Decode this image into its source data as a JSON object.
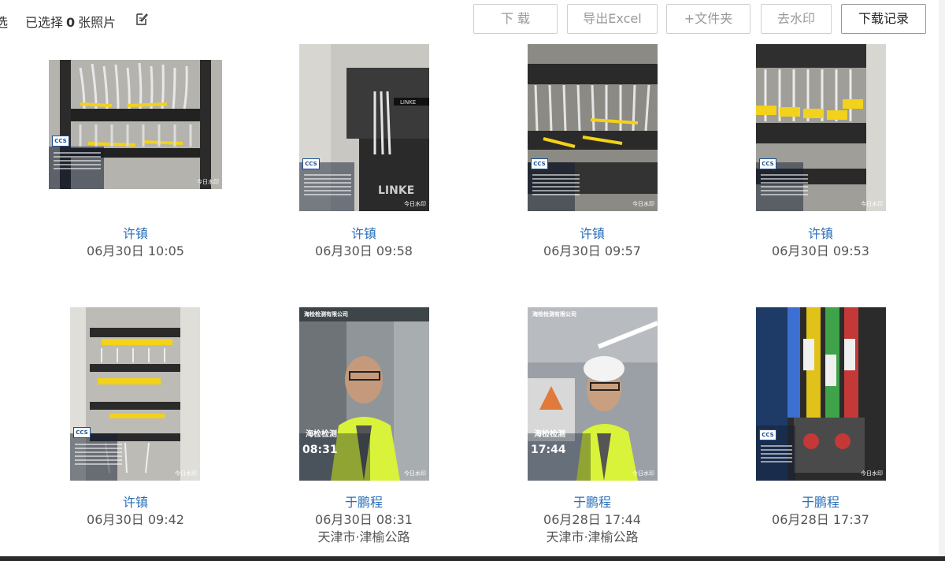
{
  "toolbar": {
    "select_all_fragment": "选",
    "selected_prefix": "已选择",
    "selected_count": "0",
    "selected_suffix": "张照片",
    "buttons": {
      "download": "下 载",
      "export_excel": "导出Excel",
      "add_folder": "+文件夹",
      "remove_watermark": "去水印",
      "download_history": "下载记录"
    }
  },
  "photos": [
    {
      "name": "许镇",
      "time": "06月30日 10:05",
      "location": ""
    },
    {
      "name": "许镇",
      "time": "06月30日 09:58",
      "location": ""
    },
    {
      "name": "许镇",
      "time": "06月30日 09:57",
      "location": ""
    },
    {
      "name": "许镇",
      "time": "06月30日 09:53",
      "location": ""
    },
    {
      "name": "许镇",
      "time": "06月30日 09:42",
      "location": ""
    },
    {
      "name": "于鹏程",
      "time": "06月30日 08:31",
      "location": "天津市·津榆公路"
    },
    {
      "name": "于鹏程",
      "time": "06月28日 17:44",
      "location": "天津市·津榆公路"
    },
    {
      "name": "于鹏程",
      "time": "06月28日 17:37",
      "location": ""
    }
  ],
  "photo_overlays": {
    "ccs_logo": "CCS",
    "watermark": "今日水印",
    "stamp1_time": "08:31",
    "stamp2_time": "17:44",
    "brand": "海检检测",
    "company": "海检检测有限公司"
  },
  "colors": {
    "name_link": "#2a6fb8",
    "cable_yellow": "#f2d21b",
    "vest_yellow": "#d9f23a"
  }
}
